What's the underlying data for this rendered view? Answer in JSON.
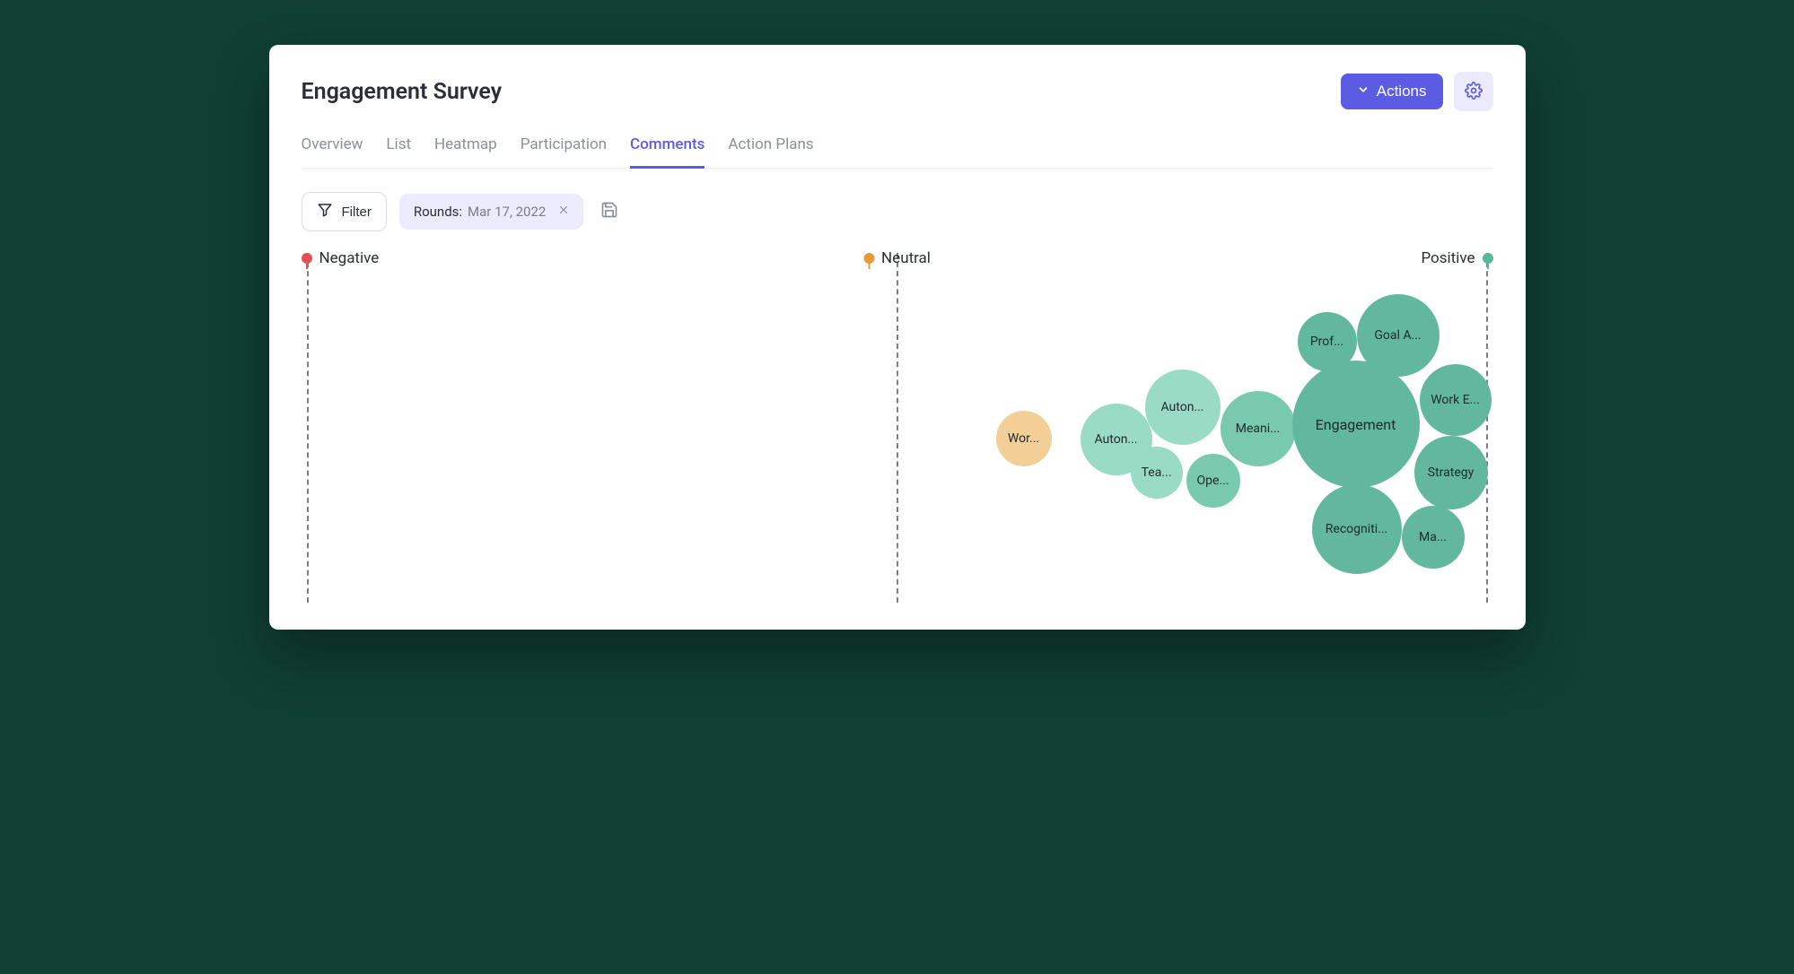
{
  "header": {
    "title": "Engagement Survey",
    "actions_label": "Actions"
  },
  "tabs": [
    {
      "label": "Overview",
      "active": false
    },
    {
      "label": "List",
      "active": false
    },
    {
      "label": "Heatmap",
      "active": false
    },
    {
      "label": "Participation",
      "active": false
    },
    {
      "label": "Comments",
      "active": true
    },
    {
      "label": "Action Plans",
      "active": false
    }
  ],
  "filter": {
    "button_label": "Filter",
    "chip_label": "Rounds:",
    "chip_value": "Mar 17, 2022"
  },
  "sentiment": {
    "negative_label": "Negative",
    "neutral_label": "Neutral",
    "positive_label": "Positive"
  },
  "chart_data": {
    "type": "bubble",
    "axis": {
      "min": -1,
      "max": 1,
      "labels": [
        "Negative",
        "Neutral",
        "Positive"
      ]
    },
    "series": [
      {
        "name": "Wor...",
        "sentiment": 0.22,
        "size": 32,
        "color": "#f2cf97"
      },
      {
        "name": "Auton...",
        "sentiment": 0.4,
        "size": 40,
        "color": "#9adbc5"
      },
      {
        "name": "Auton...",
        "sentiment": 0.52,
        "size": 42,
        "color": "#9adbc5"
      },
      {
        "name": "Tea...",
        "sentiment": 0.5,
        "size": 30,
        "color": "#9adbc5"
      },
      {
        "name": "Meani...",
        "sentiment": 0.63,
        "size": 42,
        "color": "#79c9ae"
      },
      {
        "name": "Ope...",
        "sentiment": 0.6,
        "size": 32,
        "color": "#79c9ae"
      },
      {
        "name": "Prof...",
        "sentiment": 0.78,
        "size": 34,
        "color": "#62b89d"
      },
      {
        "name": "Goal A...",
        "sentiment": 0.88,
        "size": 46,
        "color": "#62b89d"
      },
      {
        "name": "Engagement",
        "sentiment": 0.8,
        "size": 72,
        "color": "#62b89d"
      },
      {
        "name": "Work E...",
        "sentiment": 0.96,
        "size": 40,
        "color": "#62b89d"
      },
      {
        "name": "Recogniti...",
        "sentiment": 0.82,
        "size": 50,
        "color": "#62b89d"
      },
      {
        "name": "Strategy",
        "sentiment": 0.95,
        "size": 42,
        "color": "#62b89d"
      },
      {
        "name": "Ma...",
        "sentiment": 0.96,
        "size": 36,
        "color": "#62b89d"
      }
    ]
  }
}
